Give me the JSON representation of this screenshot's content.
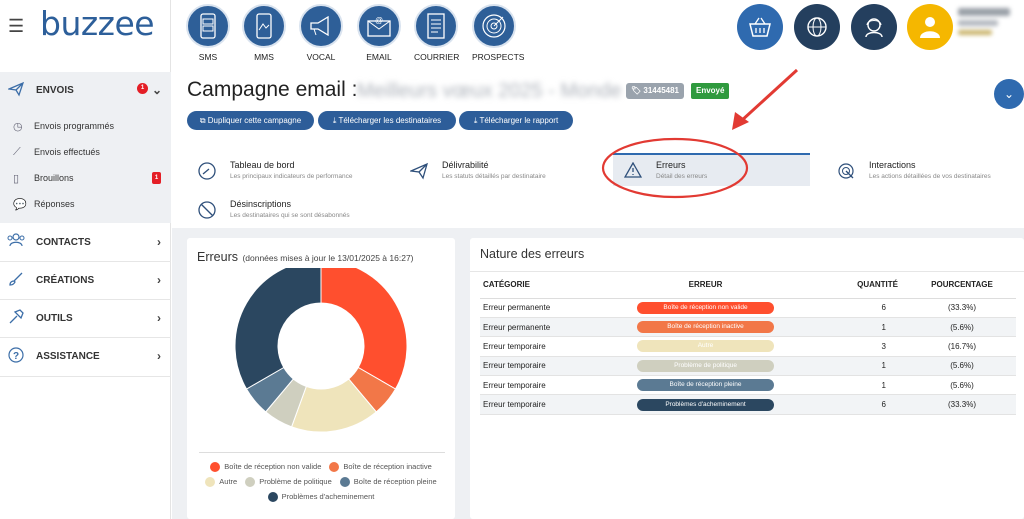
{
  "sidebar": {
    "logo": "buzzee",
    "envois": {
      "label": "ENVOIS",
      "badge": "1"
    },
    "sub_items": [
      {
        "label": "Envois programmés"
      },
      {
        "label": "Envois effectués"
      },
      {
        "label": "Brouillons",
        "badge": "1"
      },
      {
        "label": "Réponses"
      }
    ],
    "sections": [
      {
        "label": "CONTACTS"
      },
      {
        "label": "CRÉATIONS"
      },
      {
        "label": "OUTILS"
      },
      {
        "label": "ASSISTANCE"
      }
    ]
  },
  "toolbar": {
    "items": [
      {
        "label": "SMS",
        "icon": "sms-icon"
      },
      {
        "label": "MMS",
        "icon": "mms-icon"
      },
      {
        "label": "VOCAL",
        "icon": "megaphone-icon"
      },
      {
        "label": "EMAIL",
        "icon": "email-icon"
      },
      {
        "label": "COURRIER",
        "icon": "document-icon"
      },
      {
        "label": "PROSPECTS",
        "icon": "target-icon"
      }
    ],
    "right_icons": [
      "basket-icon",
      "globe-icon",
      "support-icon",
      "user-icon"
    ]
  },
  "colors": {
    "brand": "#2e5f98",
    "accent_red": "#e8412b",
    "success": "#2f9a3e"
  },
  "campaign": {
    "title": "Campagne email :",
    "name": "Meilleurs vœux 2025 - Monde",
    "id": "31445481",
    "status": "Envoyé",
    "actions": [
      "Dupliquer cette campagne",
      "Télécharger les destinataires",
      "Télécharger le rapport"
    ]
  },
  "tabs": [
    {
      "title": "Tableau de bord",
      "desc": "Les principaux indicateurs de performance"
    },
    {
      "title": "Délivrabilité",
      "desc": "Les statuts détaillés par destinataire"
    },
    {
      "title": "Erreurs",
      "desc": "Détail des erreurs"
    },
    {
      "title": "Interactions",
      "desc": "Les actions détaillées de vos destinataires"
    },
    {
      "title": "Désinscriptions",
      "desc": "Les destinataires qui se sont désabonnés"
    }
  ],
  "errors_panel": {
    "title": "Erreurs",
    "subtitle": "(données mises à jour le 13/01/2025 à 16:27)"
  },
  "nature_panel": {
    "title": "Nature des erreurs",
    "headers": [
      "CATÉGORIE",
      "ERREUR",
      "QUANTITÉ",
      "POURCENTAGE"
    ],
    "rows": [
      {
        "category": "Erreur permanente",
        "error": "Boîte de réception non valide",
        "qty": "6",
        "pct": "(33.3%)"
      },
      {
        "category": "Erreur permanente",
        "error": "Boîte de réception inactive",
        "qty": "1",
        "pct": "(5.6%)"
      },
      {
        "category": "Erreur temporaire",
        "error": "Autre",
        "qty": "3",
        "pct": "(16.7%)"
      },
      {
        "category": "Erreur temporaire",
        "error": "Problème de politique",
        "qty": "1",
        "pct": "(5.6%)"
      },
      {
        "category": "Erreur temporaire",
        "error": "Boîte de réception pleine",
        "qty": "1",
        "pct": "(5.6%)"
      },
      {
        "category": "Erreur temporaire",
        "error": "Problèmes d'acheminement",
        "qty": "6",
        "pct": "(33.3%)"
      }
    ]
  },
  "chart_data": {
    "type": "pie",
    "categories": [
      "Boîte de réception non valide",
      "Boîte de réception inactive",
      "Autre",
      "Problème de politique",
      "Boîte de réception pleine",
      "Problèmes d'acheminement"
    ],
    "values": [
      6,
      1,
      3,
      1,
      1,
      6
    ],
    "colors": [
      "#ff4f2e",
      "#f27748",
      "#efe4bb",
      "#cfcfbf",
      "#5b7a93",
      "#2b4760"
    ],
    "donut": true,
    "legend": "bottom"
  }
}
